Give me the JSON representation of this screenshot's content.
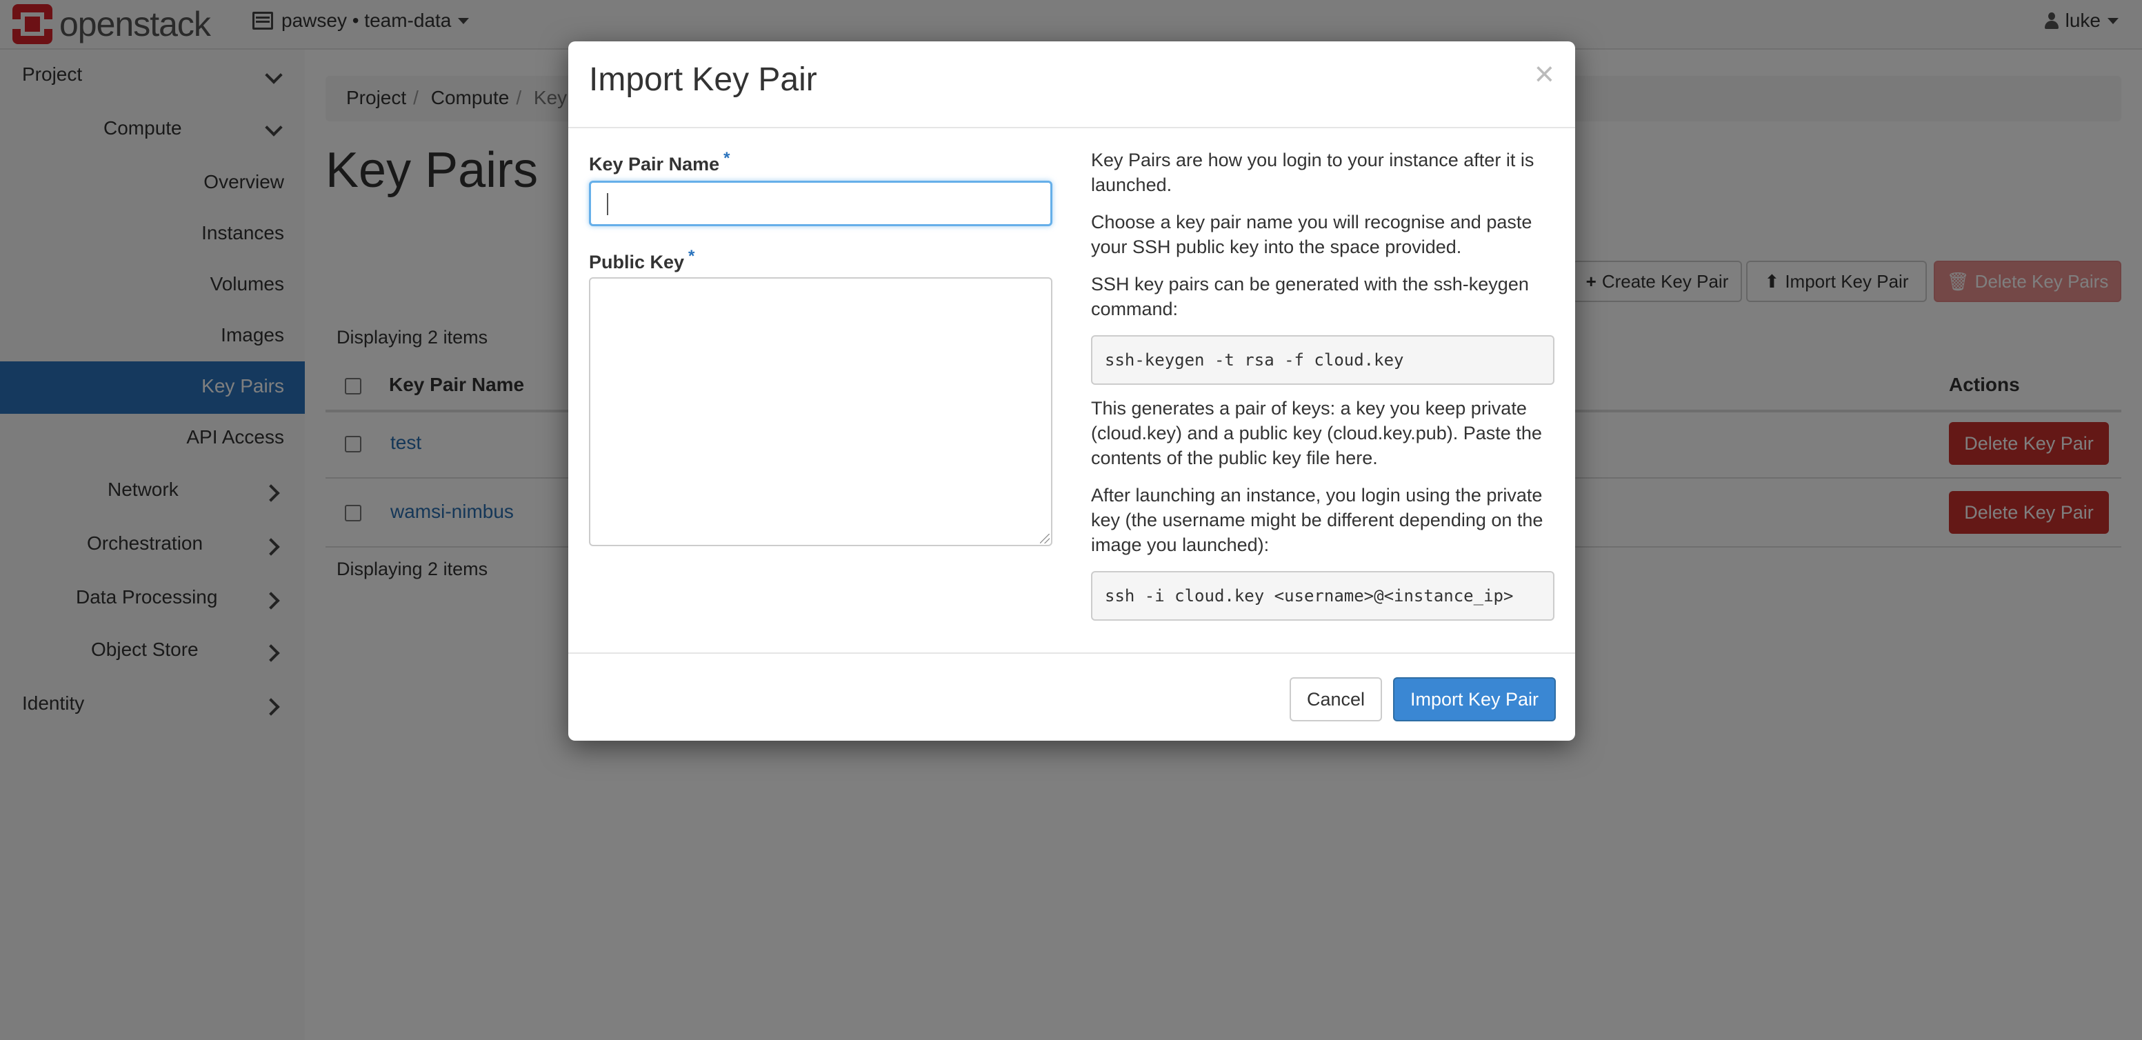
{
  "navbar": {
    "brand": "openstack",
    "project_switcher": "pawsey • team-data",
    "user": "luke"
  },
  "sidebar": {
    "project": "Project",
    "compute": "Compute",
    "items": [
      "Overview",
      "Instances",
      "Volumes",
      "Images",
      "Key Pairs",
      "API Access"
    ],
    "active": "Key Pairs",
    "network": "Network",
    "orchestration": "Orchestration",
    "data_processing": "Data Processing",
    "object_store": "Object Store",
    "identity": "Identity"
  },
  "breadcrumb": [
    "Project",
    "Compute",
    "Key Pairs"
  ],
  "page_title": "Key Pairs",
  "toolbar": {
    "create": "Create Key Pair",
    "import": "Import Key Pair",
    "delete": "Delete Key Pairs"
  },
  "table": {
    "count_top": "Displaying 2 items",
    "count_bottom": "Displaying 2 items",
    "headers": {
      "name": "Key Pair Name",
      "actions": "Actions"
    },
    "rows": [
      {
        "name": "test",
        "action": "Delete Key Pair"
      },
      {
        "name": "wamsi-nimbus",
        "action": "Delete Key Pair"
      }
    ]
  },
  "modal": {
    "title": "Import Key Pair",
    "close": "×",
    "name_label": "Key Pair Name",
    "key_label": "Public Key",
    "required_mark": "*",
    "name_value": "",
    "key_value": "",
    "help": [
      "Key Pairs are how you login to your instance after it is launched.",
      "Choose a key pair name you will recognise and paste your SSH public key into the space provided.",
      "SSH key pairs can be generated with the ssh-keygen command:",
      "This generates a pair of keys: a key you keep private (cloud.key) and a public key (cloud.key.pub). Paste the contents of the public key file here.",
      "After launching an instance, you login using the private key (the username might be different depending on the image you launched):"
    ],
    "code1": "ssh-keygen -t rsa -f cloud.key",
    "code2": "ssh -i cloud.key <username>@<instance_ip>",
    "cancel": "Cancel",
    "submit": "Import Key Pair"
  },
  "colors": {
    "primary": "#3a87d3",
    "danger": "#c9302c",
    "sidebar_active": "#2a73bd",
    "link": "#2a6fb0",
    "brand_red": "#d8222a"
  }
}
